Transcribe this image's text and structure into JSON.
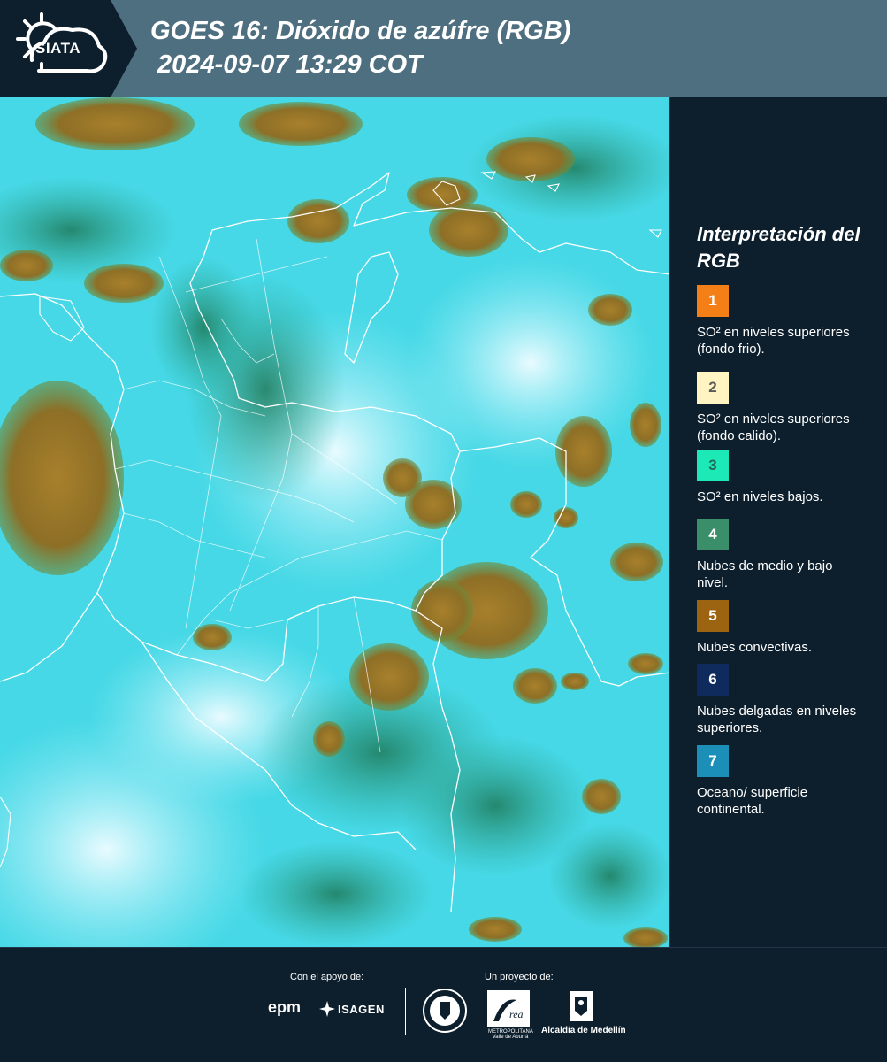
{
  "header": {
    "logo_text": "SIATA",
    "title_line1": "GOES 16: Dióxido de azúfre (RGB)",
    "title_line2": " 2024-09-07 13:29 COT"
  },
  "legend": {
    "title": "Interpretación del RGB",
    "items": [
      {
        "number": "1",
        "text": "SO² en niveles superiores (fondo frio).",
        "color": "#f57f17",
        "text_color": "#ffffff"
      },
      {
        "number": "2",
        "text": "SO² en niveles superiores (fondo calido).",
        "color": "#fff4c2",
        "text_color": "#5a5a5a"
      },
      {
        "number": "3",
        "text": "SO² en niveles bajos.",
        "color": "#1de9b6",
        "text_color": "#1f6b5a"
      },
      {
        "number": "4",
        "text": "Nubes de medio y bajo nivel.",
        "color": "#3a8f6a",
        "text_color": "#ffffff"
      },
      {
        "number": "5",
        "text": "Nubes convectivas.",
        "color": "#9c6310",
        "text_color": "#ffffff"
      },
      {
        "number": "6",
        "text": "Nubes delgadas en niveles superiores.",
        "color": "#0f2a5c",
        "text_color": "#ffffff"
      },
      {
        "number": "7",
        "text": "Oceano/ superficie continental.",
        "color": "#1b8fb8",
        "text_color": "#ffffff"
      }
    ]
  },
  "footer": {
    "support_label": "Con el apoyo de:",
    "project_label": "Un proyecto de:",
    "sponsor1": "epm",
    "sponsor2": "ISAGEN",
    "partner1": "METROPOLITANA Valle de Aburrá",
    "partner2": "Alcaldía de Medellín"
  },
  "colors": {
    "header_bg": "#4e6f80",
    "panel_bg": "#0d1f2d",
    "map_cyan": "#46d8e6",
    "cloud_brown": "#9a7a2a",
    "cloud_green": "#2f8f6a",
    "border_white": "#ffffff"
  }
}
